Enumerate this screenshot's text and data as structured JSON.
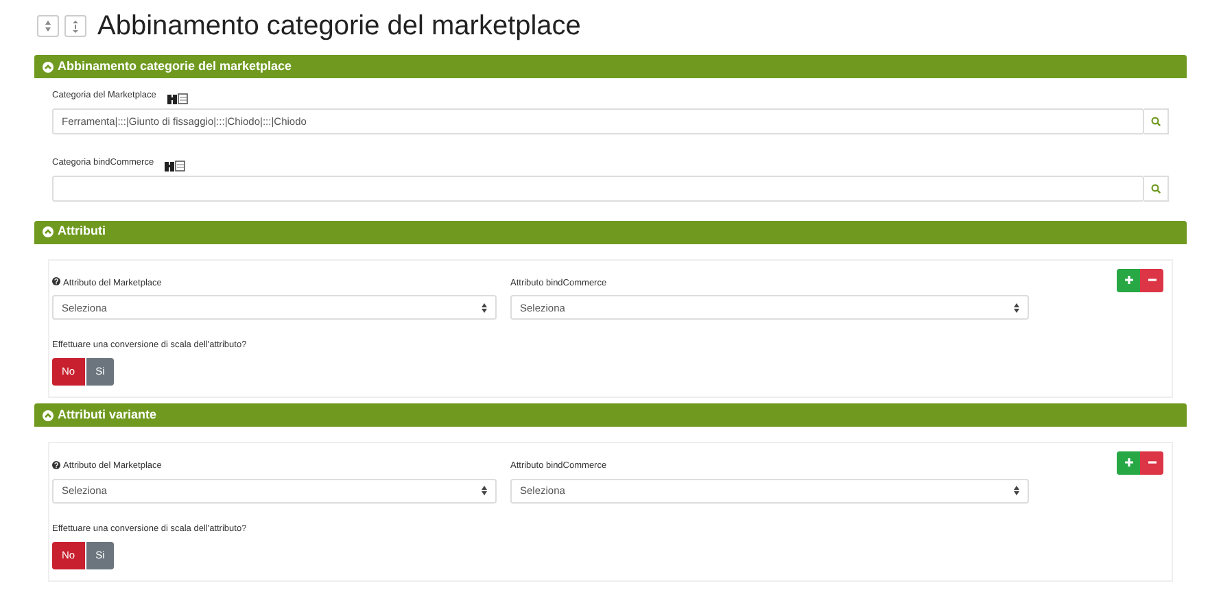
{
  "page_title": "Abbinamento categorie del marketplace",
  "category_panel": {
    "title": "Abbinamento categorie del marketplace",
    "expanded": true,
    "fields": [
      {
        "label": "Categoria del Marketplace",
        "value": "Ferramenta|:::|Giunto di fissaggio|:::|Chiodo|:::|Chiodo"
      },
      {
        "label": "Categoria bindCommerce"
      }
    ]
  },
  "attribute_panels": [
    {
      "title": "Attributi",
      "expanded": true,
      "marketplace_label": "Attributo del Marketplace",
      "marketplace_value": "Seleziona",
      "bind_label": "Attributo bindCommerce",
      "bind_value": "Seleziona",
      "question": "Effettuare una conversione di scala dell'attributo?",
      "options": [
        {
          "label": "No",
          "selected": true
        },
        {
          "label": "Si",
          "selected": false
        }
      ]
    },
    {
      "title": "Attributi variante",
      "expanded": true,
      "marketplace_label": "Attributo del Marketplace",
      "marketplace_value": "Seleziona",
      "bind_label": "Attributo bindCommerce",
      "bind_value": "Seleziona",
      "question": "Effettuare una conversione di scala dell'attributo?",
      "options": [
        {
          "label": "No",
          "selected": true
        },
        {
          "label": "Si",
          "selected": false
        }
      ]
    }
  ]
}
